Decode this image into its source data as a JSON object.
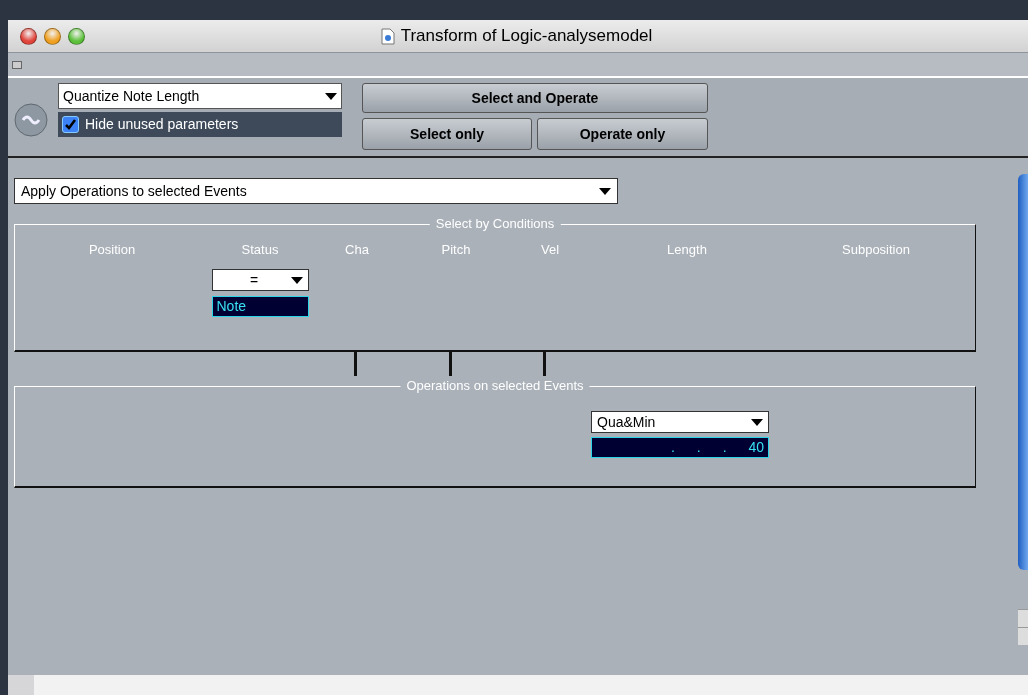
{
  "window": {
    "title": "Transform of Logic-analysemodel"
  },
  "preset": {
    "value": "Quantize Note Length"
  },
  "hide_unused": {
    "label": "Hide unused parameters",
    "checked": true
  },
  "buttons": [
    {
      "label": "Select and Operate"
    },
    {
      "label": "Select only"
    },
    {
      "label": "Operate only"
    }
  ],
  "mode": {
    "value": "Apply Operations to selected Events"
  },
  "conditions": {
    "title": "Select by Conditions",
    "columns": [
      {
        "label": "Position"
      },
      {
        "label": "Status",
        "operator": "=",
        "value": "Note"
      },
      {
        "label": "Cha"
      },
      {
        "label": "Pitch"
      },
      {
        "label": "Vel"
      },
      {
        "label": "Length"
      },
      {
        "label": "Subposition"
      }
    ]
  },
  "operations": {
    "title": "Operations on selected Events",
    "columns": [
      {},
      {},
      {},
      {},
      {},
      {
        "operator": "Qua&Min",
        "value": ". . . 40"
      },
      {}
    ]
  }
}
